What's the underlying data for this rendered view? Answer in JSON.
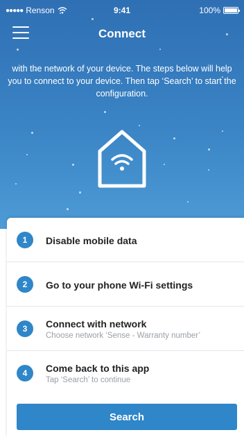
{
  "status_bar": {
    "carrier": "Renson",
    "time": "9:41",
    "battery": "100%"
  },
  "header": {
    "title": "Connect",
    "menu_icon": "hamburger-menu-icon"
  },
  "intro_text": "with the network of your device. The steps below will help you to connect to your device. Then tap ‘Search’ to start the configuration.",
  "illustration_icon": "house-wifi-icon",
  "steps": [
    {
      "number": "1",
      "label": "Disable mobile data",
      "sub": ""
    },
    {
      "number": "2",
      "label": "Go to your phone Wi-Fi settings",
      "sub": ""
    },
    {
      "number": "3",
      "label": "Connect with network",
      "sub": "Choose network ‘Sense - Warranty number’"
    },
    {
      "number": "4",
      "label": "Come back to this app",
      "sub": "Tap ‘Search’ to continue"
    }
  ],
  "search_button": "Search",
  "colors": {
    "header_gradient_top": "#2f6fb4",
    "header_gradient_bottom": "#4d9bd6",
    "accent": "#2f86c8",
    "step_subtext": "#9aa0a6"
  }
}
